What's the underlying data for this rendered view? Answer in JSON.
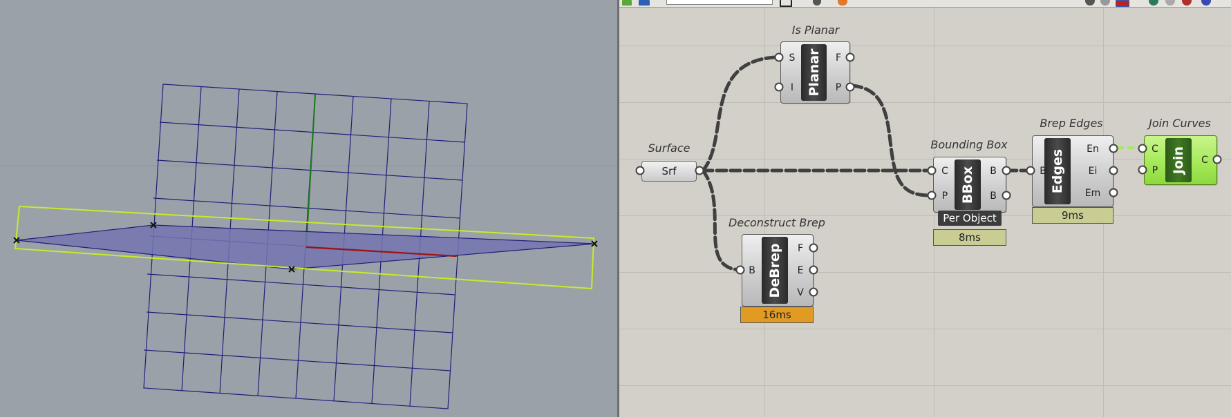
{
  "canvas": {
    "surface": {
      "caption": "Surface",
      "label": "Srf"
    },
    "is_planar": {
      "caption": "Is Planar",
      "core": "Planar",
      "inputs": [
        "S",
        "I"
      ],
      "outputs": [
        "F",
        "P"
      ]
    },
    "deconstruct_brep": {
      "caption": "Deconstruct Brep",
      "core": "DeBrep",
      "inputs": [
        "B"
      ],
      "outputs": [
        "F",
        "E",
        "V"
      ],
      "timer": "16ms"
    },
    "bounding_box": {
      "caption": "Bounding Box",
      "core": "BBox",
      "inputs": [
        "C",
        "P"
      ],
      "outputs": [
        "B",
        "B"
      ],
      "tag": "Per Object",
      "timer": "8ms"
    },
    "brep_edges": {
      "caption": "Brep Edges",
      "core": "Edges",
      "inputs": [
        "B"
      ],
      "outputs": [
        "En",
        "Ei",
        "Em"
      ],
      "timer": "9ms"
    },
    "join_curves": {
      "caption": "Join Curves",
      "core": "Join",
      "inputs": [
        "C",
        "P"
      ],
      "outputs": [
        "C"
      ]
    }
  },
  "colors": {
    "viewport_bg": "#9aa1a8",
    "grid": "#1f1f7a",
    "bbox": "#c6ec2a",
    "surface_fill": "#7474b0",
    "x_axis": "#a01010",
    "y_axis": "#1a7a1a",
    "canvas_bg": "#d3d0c9",
    "timer_ok": "#c9cc93",
    "timer_warn": "#e29b22",
    "join_green": "#a6ea5a"
  }
}
